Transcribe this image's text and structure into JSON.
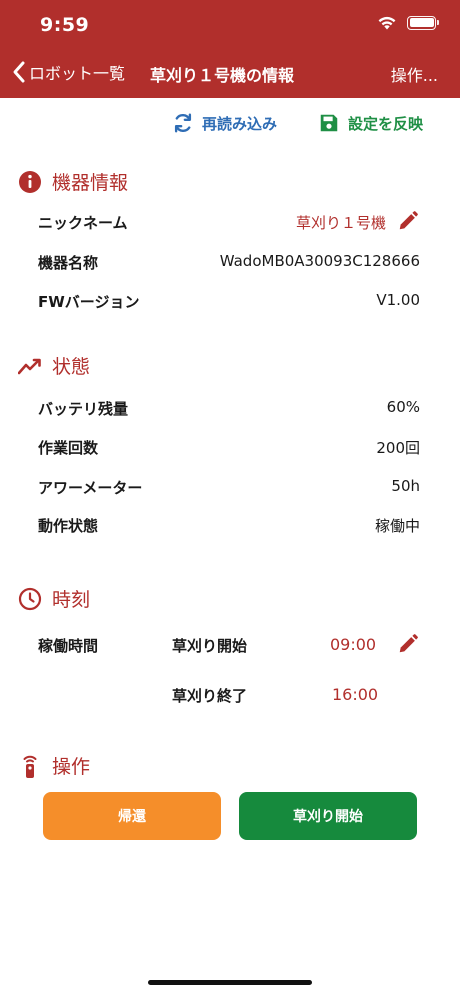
{
  "status_bar": {
    "time": "9:59"
  },
  "nav": {
    "back_label": "ロボット一覧",
    "title": "草刈り１号機の情報",
    "action_label": "操作..."
  },
  "toolbar": {
    "reload_label": "再読み込み",
    "apply_label": "設定を反映"
  },
  "device_info": {
    "heading": "機器情報",
    "rows": [
      {
        "label": "ニックネーム",
        "value": "草刈り１号機"
      },
      {
        "label": "機器名称",
        "value": "WadoMB0A30093C128666"
      },
      {
        "label": "FWバージョン",
        "value": "V1.00"
      }
    ]
  },
  "status": {
    "heading": "状態",
    "rows": [
      {
        "label": "バッテリ残量",
        "value": "60%"
      },
      {
        "label": "作業回数",
        "value": "200回"
      },
      {
        "label": "アワーメーター",
        "value": "50h"
      },
      {
        "label": "動作状態",
        "value": "稼働中"
      }
    ]
  },
  "time": {
    "heading": "時刻",
    "operating_hours_label": "稼働時間",
    "start_label": "草刈り開始",
    "start_value": "09:00",
    "end_label": "草刈り終了",
    "end_value": "16:00"
  },
  "operation": {
    "heading": "操作",
    "return_label": "帰還",
    "start_label": "草刈り開始"
  },
  "colors": {
    "header": "#b12f2c",
    "accent_red": "#b12f2c",
    "reload_blue": "#2f6db5",
    "apply_green": "#1f8f45",
    "return_orange": "#f58e2a",
    "start_green": "#168a3d"
  }
}
